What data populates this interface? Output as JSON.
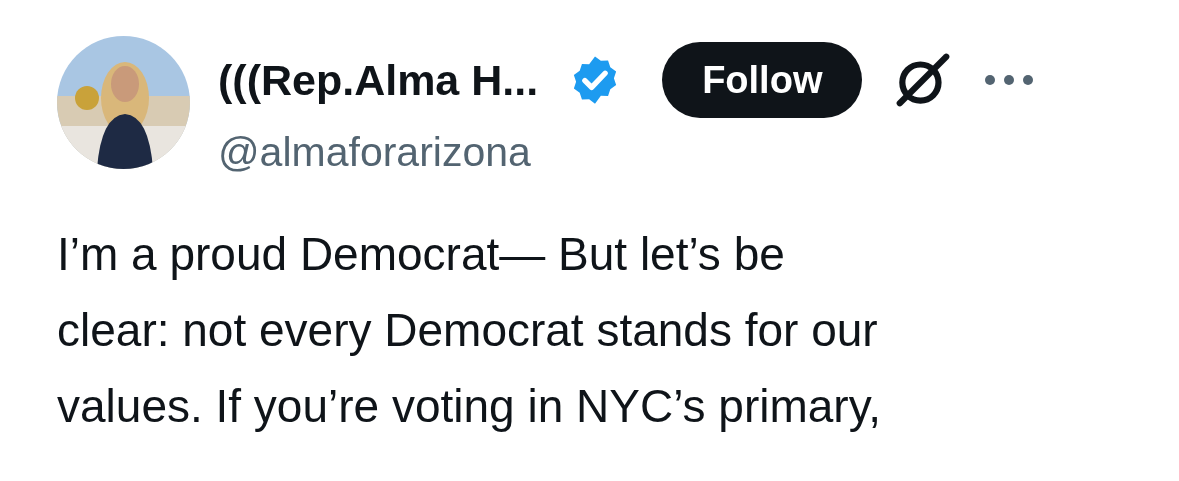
{
  "author": {
    "name": "(((Rep.Alma H...",
    "verified": true,
    "handle": "@almaforarizona"
  },
  "follow_button": {
    "label": "Follow"
  },
  "post": {
    "lines": [
      "I’m a proud Democrat— But let’s be",
      "clear: not every Democrat stands for our",
      "values. If you’re voting in NYC’s primary,"
    ]
  }
}
